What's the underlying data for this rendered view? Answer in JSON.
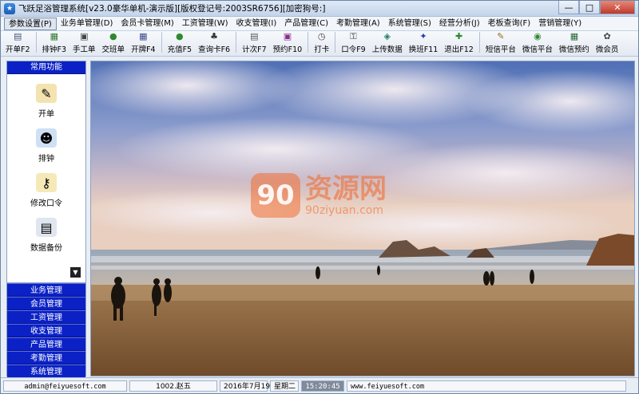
{
  "window": {
    "title": "飞跃足浴管理系统[v23.0豪华单机-演示版][版权登记号:2003SR6756][加密狗号:]",
    "controls": {
      "minimize": "—",
      "maximize": "□",
      "close": "✕"
    }
  },
  "menu": [
    {
      "label": "参数设置(P)",
      "active": true
    },
    {
      "label": "业务单管理(D)"
    },
    {
      "label": "会员卡管理(M)"
    },
    {
      "label": "工资管理(W)"
    },
    {
      "label": "收支管理(I)"
    },
    {
      "label": "产品管理(C)"
    },
    {
      "label": "考勤管理(A)"
    },
    {
      "label": "系统管理(S)"
    },
    {
      "label": "经营分析(J)"
    },
    {
      "label": "老板查询(F)"
    },
    {
      "label": "营销管理(Y)"
    }
  ],
  "toolbar": [
    {
      "label": "开单F2",
      "icon": "open-bill-icon",
      "glyph": "▤",
      "color": "#4a5a7a"
    },
    {
      "label": "排钟F3",
      "icon": "schedule-icon",
      "glyph": "▦",
      "color": "#2f7a2f"
    },
    {
      "label": "手工单",
      "icon": "manual-bill-icon",
      "glyph": "▣",
      "color": "#444"
    },
    {
      "label": "交班单",
      "icon": "handover-icon",
      "glyph": "●",
      "color": "#2d8a2d"
    },
    {
      "label": "开牌F4",
      "icon": "grid-icon",
      "glyph": "▦",
      "color": "#3a4a8a"
    },
    {
      "label": "充值F5",
      "icon": "recharge-icon",
      "glyph": "●",
      "color": "#2d8a2d"
    },
    {
      "label": "查询卡F6",
      "icon": "binoculars-icon",
      "glyph": "♣",
      "color": "#333"
    },
    {
      "label": "计次F7",
      "icon": "counter-icon",
      "glyph": "▤",
      "color": "#555"
    },
    {
      "label": "预约F10",
      "icon": "reservation-icon",
      "glyph": "▣",
      "color": "#8a2d8a"
    },
    {
      "label": "打卡",
      "icon": "clock-icon",
      "glyph": "◷",
      "color": "#444"
    },
    {
      "label": "口令F9",
      "icon": "key-icon",
      "glyph": "⚿",
      "color": "#333"
    },
    {
      "label": "上传数据",
      "icon": "upload-icon",
      "glyph": "◈",
      "color": "#1f7a6a"
    },
    {
      "label": "换班F11",
      "icon": "shift-change-icon",
      "glyph": "✦",
      "color": "#2a3aa8"
    },
    {
      "label": "退出F12",
      "icon": "exit-icon",
      "glyph": "✚",
      "color": "#2d8a2d"
    },
    {
      "label": "短信平台",
      "icon": "sms-icon",
      "glyph": "✎",
      "color": "#9a6a1a"
    },
    {
      "label": "微信平台",
      "icon": "wechat-icon",
      "glyph": "◉",
      "color": "#2d8a2d"
    },
    {
      "label": "微信预约",
      "icon": "wechat-reserve-icon",
      "glyph": "▦",
      "color": "#2a6a3a"
    },
    {
      "label": "微会员",
      "icon": "micro-member-icon",
      "glyph": "✿",
      "color": "#444"
    }
  ],
  "sidebar": {
    "header": "常用功能",
    "entries": [
      {
        "label": "开单",
        "icon": "notepad-pencil-icon",
        "glyph": "✎",
        "bg": "#f3e3b0"
      },
      {
        "label": "排钟",
        "icon": "user-schedule-icon",
        "glyph": "☻",
        "bg": "#cfe0f5"
      },
      {
        "label": "修改口令",
        "icon": "users-key-icon",
        "glyph": "⚷",
        "bg": "#f5e9b8"
      },
      {
        "label": "数据备份",
        "icon": "backup-icon",
        "glyph": "▤",
        "bg": "#e0e6ef"
      }
    ],
    "scroll_glyph": "▼",
    "groups": [
      "业务管理",
      "会员管理",
      "工资管理",
      "收支管理",
      "产品管理",
      "考勤管理",
      "系统管理"
    ]
  },
  "watermark": {
    "logo": "90",
    "main": "资源网",
    "sub": "90ziyuan.com"
  },
  "status": {
    "email": "admin@feiyuesoft.com",
    "user": "1002.赵五",
    "date": "2016年7月19日",
    "weekday": "星期二",
    "time": "15:20:45",
    "website": "www.feiyuesoft.com"
  }
}
